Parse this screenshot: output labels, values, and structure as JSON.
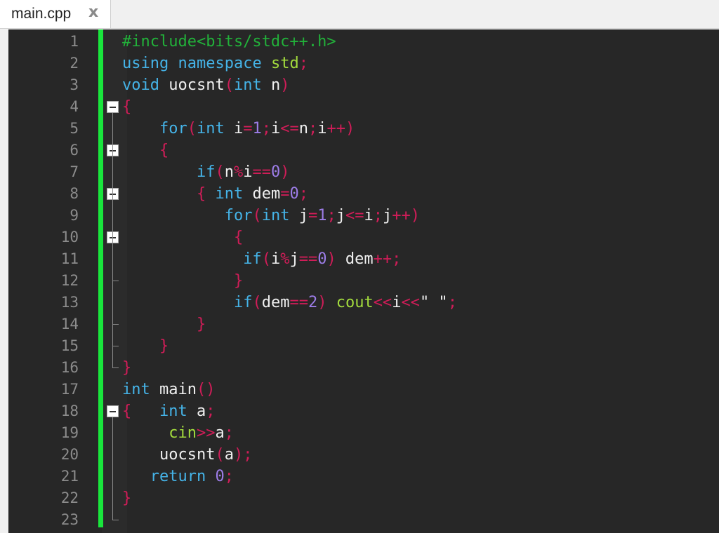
{
  "tab": {
    "label": "main.cpp",
    "close_glyph": "x"
  },
  "colors": {
    "background": "#272727",
    "change_bar": "#19e63c",
    "preprocessor": "#22b13a",
    "keyword": "#45b3e7",
    "identifier": "#f0f0f0",
    "punctuation": "#d01d58",
    "number": "#9d7de8",
    "library": "#a3db3d"
  },
  "line_numbers": [
    "1",
    "2",
    "3",
    "4",
    "5",
    "6",
    "7",
    "8",
    "9",
    "10",
    "11",
    "12",
    "13",
    "14",
    "15",
    "16",
    "17",
    "18",
    "19",
    "20",
    "21",
    "22",
    "23"
  ],
  "code": [
    [
      [
        "pre",
        "#include<bits/stdc++.h>"
      ]
    ],
    [
      [
        "kw",
        "using"
      ],
      [
        "id",
        " "
      ],
      [
        "kw",
        "namespace"
      ],
      [
        "id",
        " "
      ],
      [
        "lib",
        "std"
      ],
      [
        "punc",
        ";"
      ]
    ],
    [
      [
        "type",
        "void"
      ],
      [
        "id",
        " uocsnt"
      ],
      [
        "punc",
        "("
      ],
      [
        "type",
        "int"
      ],
      [
        "id",
        " n"
      ],
      [
        "punc",
        ")"
      ]
    ],
    [
      [
        "punc",
        "{"
      ]
    ],
    [
      [
        "id",
        "    "
      ],
      [
        "kw",
        "for"
      ],
      [
        "punc",
        "("
      ],
      [
        "type",
        "int"
      ],
      [
        "id",
        " i"
      ],
      [
        "punc",
        "="
      ],
      [
        "num",
        "1"
      ],
      [
        "punc",
        ";"
      ],
      [
        "id",
        "i"
      ],
      [
        "punc",
        "<="
      ],
      [
        "id",
        "n"
      ],
      [
        "punc",
        ";"
      ],
      [
        "id",
        "i"
      ],
      [
        "punc",
        "++)"
      ]
    ],
    [
      [
        "id",
        "    "
      ],
      [
        "punc",
        "{"
      ]
    ],
    [
      [
        "id",
        "        "
      ],
      [
        "kw",
        "if"
      ],
      [
        "punc",
        "("
      ],
      [
        "id",
        "n"
      ],
      [
        "punc",
        "%"
      ],
      [
        "id",
        "i"
      ],
      [
        "punc",
        "=="
      ],
      [
        "num",
        "0"
      ],
      [
        "punc",
        ")"
      ]
    ],
    [
      [
        "id",
        "        "
      ],
      [
        "punc",
        "{"
      ],
      [
        "id",
        " "
      ],
      [
        "type",
        "int"
      ],
      [
        "id",
        " dem"
      ],
      [
        "punc",
        "="
      ],
      [
        "num",
        "0"
      ],
      [
        "punc",
        ";"
      ]
    ],
    [
      [
        "id",
        "           "
      ],
      [
        "kw",
        "for"
      ],
      [
        "punc",
        "("
      ],
      [
        "type",
        "int"
      ],
      [
        "id",
        " j"
      ],
      [
        "punc",
        "="
      ],
      [
        "num",
        "1"
      ],
      [
        "punc",
        ";"
      ],
      [
        "id",
        "j"
      ],
      [
        "punc",
        "<="
      ],
      [
        "id",
        "i"
      ],
      [
        "punc",
        ";"
      ],
      [
        "id",
        "j"
      ],
      [
        "punc",
        "++)"
      ]
    ],
    [
      [
        "id",
        "            "
      ],
      [
        "punc",
        "{"
      ]
    ],
    [
      [
        "id",
        "             "
      ],
      [
        "kw",
        "if"
      ],
      [
        "punc",
        "("
      ],
      [
        "id",
        "i"
      ],
      [
        "punc",
        "%"
      ],
      [
        "id",
        "j"
      ],
      [
        "punc",
        "=="
      ],
      [
        "num",
        "0"
      ],
      [
        "punc",
        ")"
      ],
      [
        "id",
        " dem"
      ],
      [
        "punc",
        "++;"
      ]
    ],
    [
      [
        "id",
        "            "
      ],
      [
        "punc",
        "}"
      ]
    ],
    [
      [
        "id",
        "            "
      ],
      [
        "kw",
        "if"
      ],
      [
        "punc",
        "("
      ],
      [
        "id",
        "dem"
      ],
      [
        "punc",
        "=="
      ],
      [
        "num",
        "2"
      ],
      [
        "punc",
        ")"
      ],
      [
        "id",
        " "
      ],
      [
        "lib",
        "cout"
      ],
      [
        "punc",
        "<<"
      ],
      [
        "id",
        "i"
      ],
      [
        "punc",
        "<<"
      ],
      [
        "str",
        "\" \""
      ],
      [
        "punc",
        ";"
      ]
    ],
    [
      [
        "id",
        "        "
      ],
      [
        "punc",
        "}"
      ]
    ],
    [
      [
        "id",
        "    "
      ],
      [
        "punc",
        "}"
      ]
    ],
    [
      [
        "punc",
        "}"
      ]
    ],
    [
      [
        "type",
        "int"
      ],
      [
        "id",
        " main"
      ],
      [
        "punc",
        "()"
      ]
    ],
    [
      [
        "punc",
        "{"
      ],
      [
        "id",
        "   "
      ],
      [
        "type",
        "int"
      ],
      [
        "id",
        " a"
      ],
      [
        "punc",
        ";"
      ]
    ],
    [
      [
        "id",
        "     "
      ],
      [
        "lib",
        "cin"
      ],
      [
        "punc",
        ">>"
      ],
      [
        "id",
        "a"
      ],
      [
        "punc",
        ";"
      ]
    ],
    [
      [
        "id",
        "    uocsnt"
      ],
      [
        "punc",
        "("
      ],
      [
        "id",
        "a"
      ],
      [
        "punc",
        ");"
      ]
    ],
    [
      [
        "id",
        "   "
      ],
      [
        "kw",
        "return"
      ],
      [
        "id",
        " "
      ],
      [
        "num",
        "0"
      ],
      [
        "punc",
        ";"
      ]
    ],
    [
      [
        "punc",
        "}"
      ]
    ],
    [
      [
        "id",
        ""
      ]
    ]
  ],
  "fold_markers": [
    4,
    6,
    8,
    10,
    18
  ]
}
